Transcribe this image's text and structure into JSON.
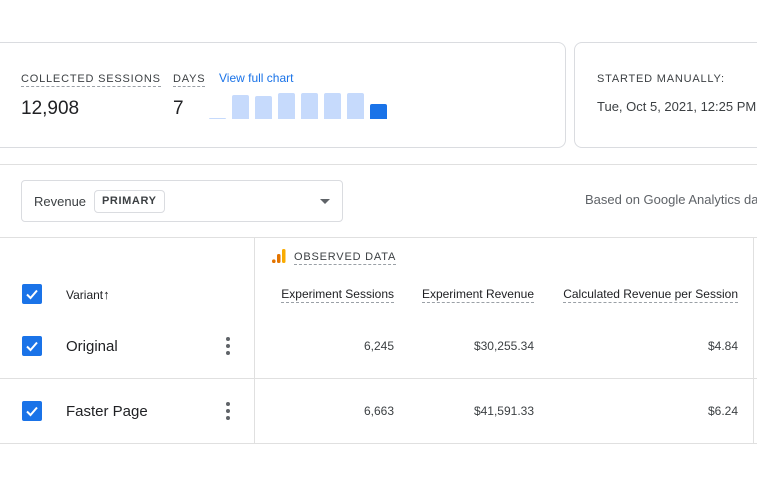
{
  "stats": {
    "sessions_label": "COLLECTED SESSIONS",
    "sessions_value": "12,908",
    "days_label": "DAYS",
    "days_value": "7",
    "view_chart_link": "View full chart",
    "daily_levels": [
      0.02,
      0.8,
      0.75,
      0.85,
      0.85,
      0.85,
      0.88,
      0.5
    ]
  },
  "started": {
    "label": "STARTED MANUALLY:",
    "value": "Tue, Oct 5, 2021, 12:25 PM"
  },
  "metric_select": {
    "value": "Revenue",
    "chip": "PRIMARY"
  },
  "based_on": "Based on Google Analytics da",
  "table": {
    "variant_header": "Variant",
    "sort_arrow": "↑",
    "group_label": "OBSERVED DATA",
    "columns": [
      "Experiment Sessions",
      "Experiment Revenue",
      "Calculated Revenue per Session"
    ],
    "rows": [
      {
        "name": "Original",
        "values": [
          "6,245",
          "$30,255.34",
          "$4.84"
        ]
      },
      {
        "name": "Faster Page",
        "values": [
          "6,663",
          "$41,591.33",
          "$6.24"
        ]
      }
    ]
  },
  "colors": {
    "accent": "#1a73e8",
    "bar_light": "#c6dafc",
    "analytics_orange": "#f9ab00",
    "analytics_dark_orange": "#e37400"
  }
}
